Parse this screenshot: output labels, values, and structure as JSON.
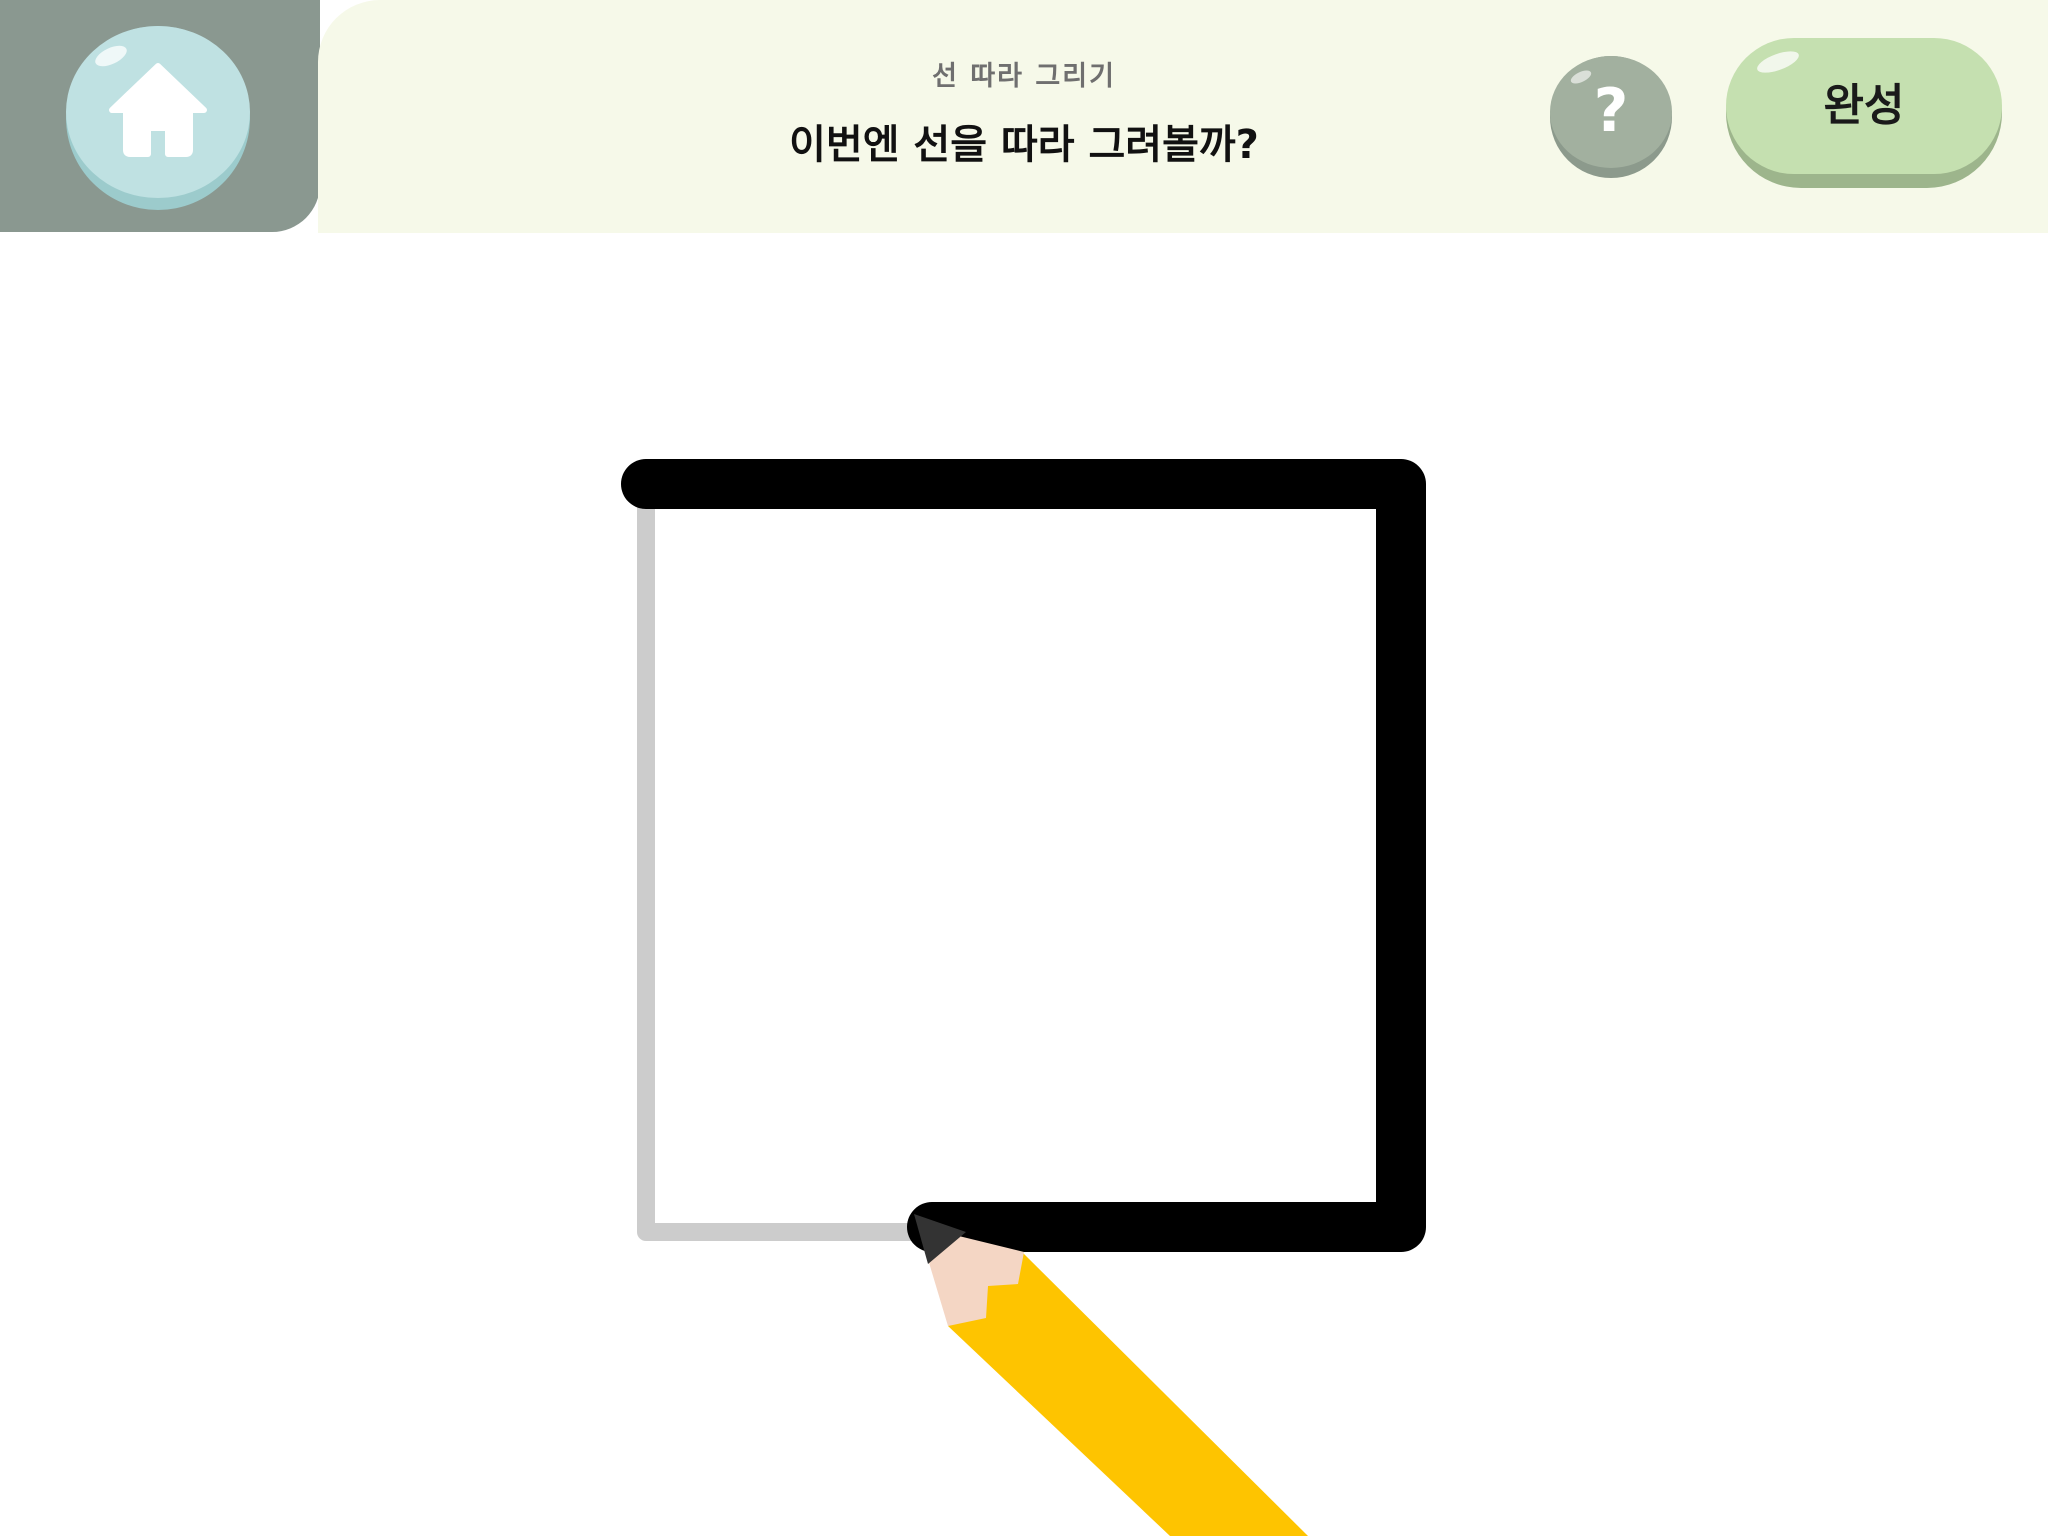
{
  "header": {
    "subtitle": "선 따라 그리기",
    "title": "이번엔 선을 따라 그려볼까?",
    "help_label": "?",
    "done_label": "완성"
  },
  "icons": {
    "home": "home-icon",
    "help": "question-icon",
    "pencil": "pencil-icon"
  },
  "colors": {
    "corner_block": "#8a9890",
    "header_bg": "#f6f9e9",
    "home_button": "#bfe1e2",
    "help_button": "#a2b09f",
    "done_button": "#c5e0b0",
    "guide_line": "#cccccc",
    "drawn_line": "#000000",
    "pencil_body": "#fec400",
    "pencil_wood": "#f4d6c4",
    "pencil_lead": "#333333"
  },
  "tracing": {
    "shape": "square",
    "progress": 0.8
  }
}
